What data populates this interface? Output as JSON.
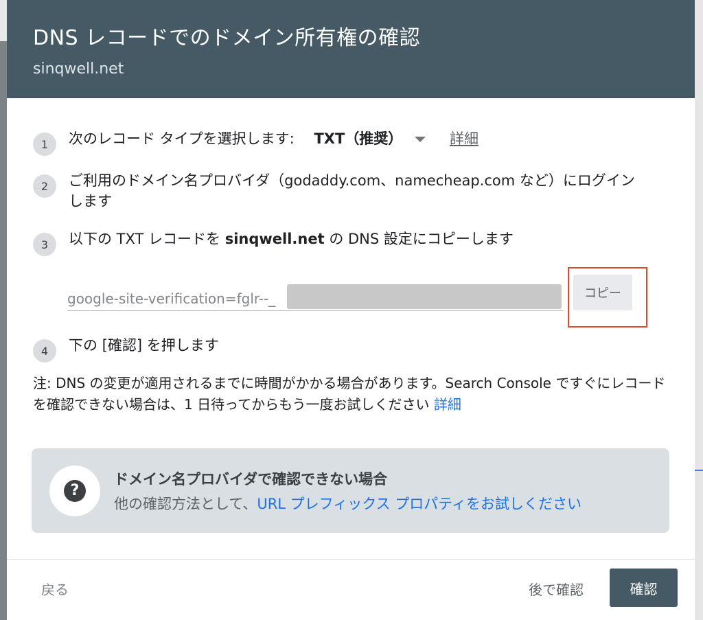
{
  "dialog": {
    "title": "DNS レコードでのドメイン所有権の確認",
    "subtitle": "sinqwell.net"
  },
  "steps": [
    {
      "num": "1",
      "text": "次のレコード タイプを選択します:",
      "select_value": "TXT（推奨）",
      "details_link": "詳細"
    },
    {
      "num": "2",
      "text_line1": "ご利用のドメイン名プロバイダ（godaddy.com、namecheap.com など）にログイン",
      "text_line2": "します"
    },
    {
      "num": "3",
      "text_pre": "以下の TXT レコードを ",
      "domain": "sinqwell.net",
      "text_post": " の DNS 設定にコピーします"
    },
    {
      "num": "4",
      "text": "下の [確認] を押します"
    }
  ],
  "record": {
    "value": "google-site-verification=fglr--_",
    "copy_label": "コピー"
  },
  "note": {
    "text": "注: DNS の変更が適用されるまでに時間がかかる場合があります。Search Console ですぐにレコードを確認できない場合は、1 日待ってからもう一度お試しください",
    "link": "詳細"
  },
  "help": {
    "title": "ドメイン名プロバイダで確認できない場合",
    "text_pre": "他の確認方法として、",
    "link": "URL プレフィックス プロパティをお試しください"
  },
  "footer": {
    "back": "戻る",
    "later": "後で確認",
    "confirm": "確認"
  },
  "colors": {
    "header_bg": "#455a64",
    "link_blue": "#1a73e8",
    "highlight_red": "#e8472a"
  }
}
